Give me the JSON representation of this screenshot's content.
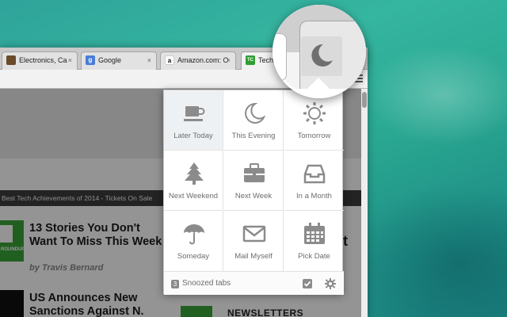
{
  "tabs": [
    {
      "title": "Electronics, Ca",
      "favicon": "ebay-favicon",
      "close": "×"
    },
    {
      "title": "Google",
      "favicon": "google-favicon",
      "glyph": "g",
      "close": "×"
    },
    {
      "title": "Amazon.com: O",
      "favicon": "amazon-favicon",
      "glyph": "a",
      "close": "×"
    },
    {
      "title": "TechC",
      "favicon": "techcrunch-favicon",
      "glyph": "TC"
    }
  ],
  "page": {
    "ticker": "Best Tech Achievements of 2014 - Tickets On Sale",
    "story1": {
      "title": "13 Stories You Don't Want To Miss This Week",
      "author": "by Travis Bernard"
    },
    "story2": {
      "title": "US Announces New Sanctions Against N."
    },
    "thumb_label": "ROUNDUP",
    "right_fragment": "t",
    "newsletters": "NEWSLETTERS"
  },
  "popup": {
    "options": [
      {
        "label": "Later Today",
        "icon": "coffee-cup-icon",
        "selected": true
      },
      {
        "label": "This Evening",
        "icon": "moon-icon"
      },
      {
        "label": "Tomorrow",
        "icon": "sun-icon"
      },
      {
        "label": "Next Weekend",
        "icon": "tree-icon"
      },
      {
        "label": "Next Week",
        "icon": "briefcase-icon"
      },
      {
        "label": "In a Month",
        "icon": "inbox-tray-icon"
      },
      {
        "label": "Someday",
        "icon": "umbrella-icon"
      },
      {
        "label": "Mail Myself",
        "icon": "envelope-icon"
      },
      {
        "label": "Pick Date",
        "icon": "calendar-icon"
      }
    ],
    "footer": {
      "count": "3",
      "label": "Snoozed tabs"
    }
  },
  "colors": {
    "icon_gray": "#8b8b8b",
    "selected_bg": "#eef1f3",
    "accent_green": "#39a43a"
  }
}
